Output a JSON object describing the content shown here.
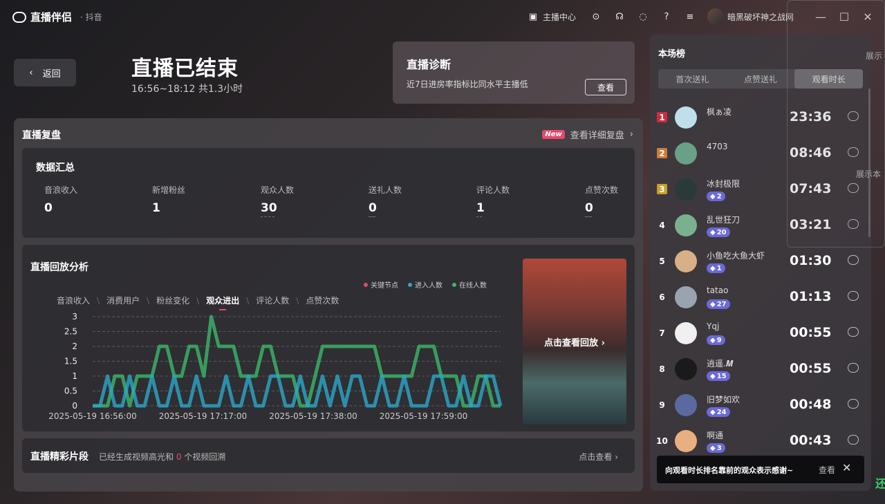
{
  "app": {
    "name": "直播伴侣",
    "platform": "· 抖音",
    "creator_center": "主播中心",
    "username": "暗黑破坏神之战网"
  },
  "header": {
    "back": "返回",
    "title": "直播已结束",
    "subtitle": "16:56~18:12 共1.3小时"
  },
  "diagnosis": {
    "title": "直播诊断",
    "desc": "近7日进房率指标比同水平主播低",
    "button": "查看"
  },
  "review": {
    "title": "直播复盘",
    "badge": "New",
    "link": "查看详细复盘"
  },
  "summary": {
    "title": "数据汇总",
    "stats": [
      {
        "label": "音浪收入",
        "value": "0"
      },
      {
        "label": "新增粉丝",
        "value": "1"
      },
      {
        "label": "观众人数",
        "value": "30"
      },
      {
        "label": "送礼人数",
        "value": "0"
      },
      {
        "label": "评论人数",
        "value": "1"
      },
      {
        "label": "点赞次数",
        "value": "0"
      }
    ]
  },
  "analysis": {
    "title": "直播回放分析",
    "legend": [
      {
        "label": "关键节点",
        "color": "#e5486e"
      },
      {
        "label": "进入人数",
        "color": "#2aa8c8"
      },
      {
        "label": "在线人数",
        "color": "#3ab86a"
      }
    ],
    "tabs": [
      "音浪收入",
      "消费用户",
      "粉丝变化",
      "观众进出",
      "评论人数",
      "点赞次数"
    ],
    "active_tab": "观众进出",
    "replay": "点击查看回放 ›"
  },
  "chart_data": {
    "type": "line",
    "yticks": [
      "3",
      "2.5",
      "2",
      "1.5",
      "1",
      "0.5",
      "0"
    ],
    "xticks": [
      "2025-05-19 16:56:00",
      "2025-05-19 17:17:00",
      "2025-05-19 17:38:00",
      "2025-05-19 17:59:00"
    ],
    "ylim": [
      0,
      3
    ],
    "series": [
      {
        "name": "在线人数",
        "color": "#3ab86a",
        "values": [
          0,
          0,
          0,
          1,
          1,
          0,
          1,
          1,
          1,
          2,
          2,
          1,
          1,
          2,
          2,
          1,
          3,
          2,
          2,
          2,
          1,
          1,
          1,
          2,
          2,
          1,
          1,
          1,
          0,
          0,
          1,
          2,
          2,
          2,
          2,
          2,
          2,
          2,
          2,
          1,
          1,
          1,
          1,
          1,
          2,
          2,
          2,
          1,
          1,
          1,
          0,
          0,
          1,
          1,
          0,
          0
        ]
      },
      {
        "name": "进入人数",
        "color": "#2aa8c8",
        "values": [
          0,
          0,
          1,
          0,
          0,
          1,
          0,
          0,
          1,
          0,
          0,
          1,
          0,
          0,
          1,
          0,
          0,
          0,
          1,
          0,
          0,
          1,
          0,
          0,
          1,
          1,
          0,
          0,
          1,
          0,
          0,
          1,
          0,
          1,
          0,
          1,
          1,
          0,
          0,
          1,
          0,
          0,
          1,
          0,
          0,
          0,
          1,
          1,
          0,
          0,
          1,
          0,
          0,
          1,
          1,
          0
        ]
      }
    ]
  },
  "clips": {
    "title": "直播精彩片段",
    "desc_pre": "已经生成视频高光和 ",
    "count": "0",
    "desc_post": " 个视频回溯",
    "link": "点击查看 ›"
  },
  "ranking": {
    "title": "本场榜",
    "tabs": [
      "首次送礼",
      "点赞送礼",
      "观看时长"
    ],
    "active_tab": "观看时长",
    "rows": [
      {
        "rank": "1",
        "name": "枫ぁ凌",
        "badge": "",
        "time": "23:36"
      },
      {
        "rank": "2",
        "name": "4703",
        "badge": "",
        "time": "08:46"
      },
      {
        "rank": "3",
        "name": "冰封极限",
        "badge": "2",
        "time": "07:43"
      },
      {
        "rank": "4",
        "name": "乱世狂刀",
        "badge": "20",
        "time": "03:21"
      },
      {
        "rank": "5",
        "name": "小鱼吃大鱼大虾",
        "badge": "1",
        "time": "01:30"
      },
      {
        "rank": "6",
        "name": "tatao",
        "badge": "27",
        "time": "01:13"
      },
      {
        "rank": "7",
        "name": "Yqj",
        "badge": "9",
        "time": "00:55"
      },
      {
        "rank": "8",
        "name": "逍遥.𝑴",
        "badge": "15",
        "time": "00:55"
      },
      {
        "rank": "9",
        "name": "旧梦如欢",
        "badge": "24",
        "time": "00:48"
      },
      {
        "rank": "10",
        "name": "啊通",
        "badge": "3",
        "time": "00:43"
      }
    ]
  },
  "toast": {
    "text": "向观看时长排名靠前的观众表示感谢~",
    "view": "查看"
  },
  "overlay": {
    "label1": "展示",
    "label2": "展示本",
    "label3": "还"
  }
}
